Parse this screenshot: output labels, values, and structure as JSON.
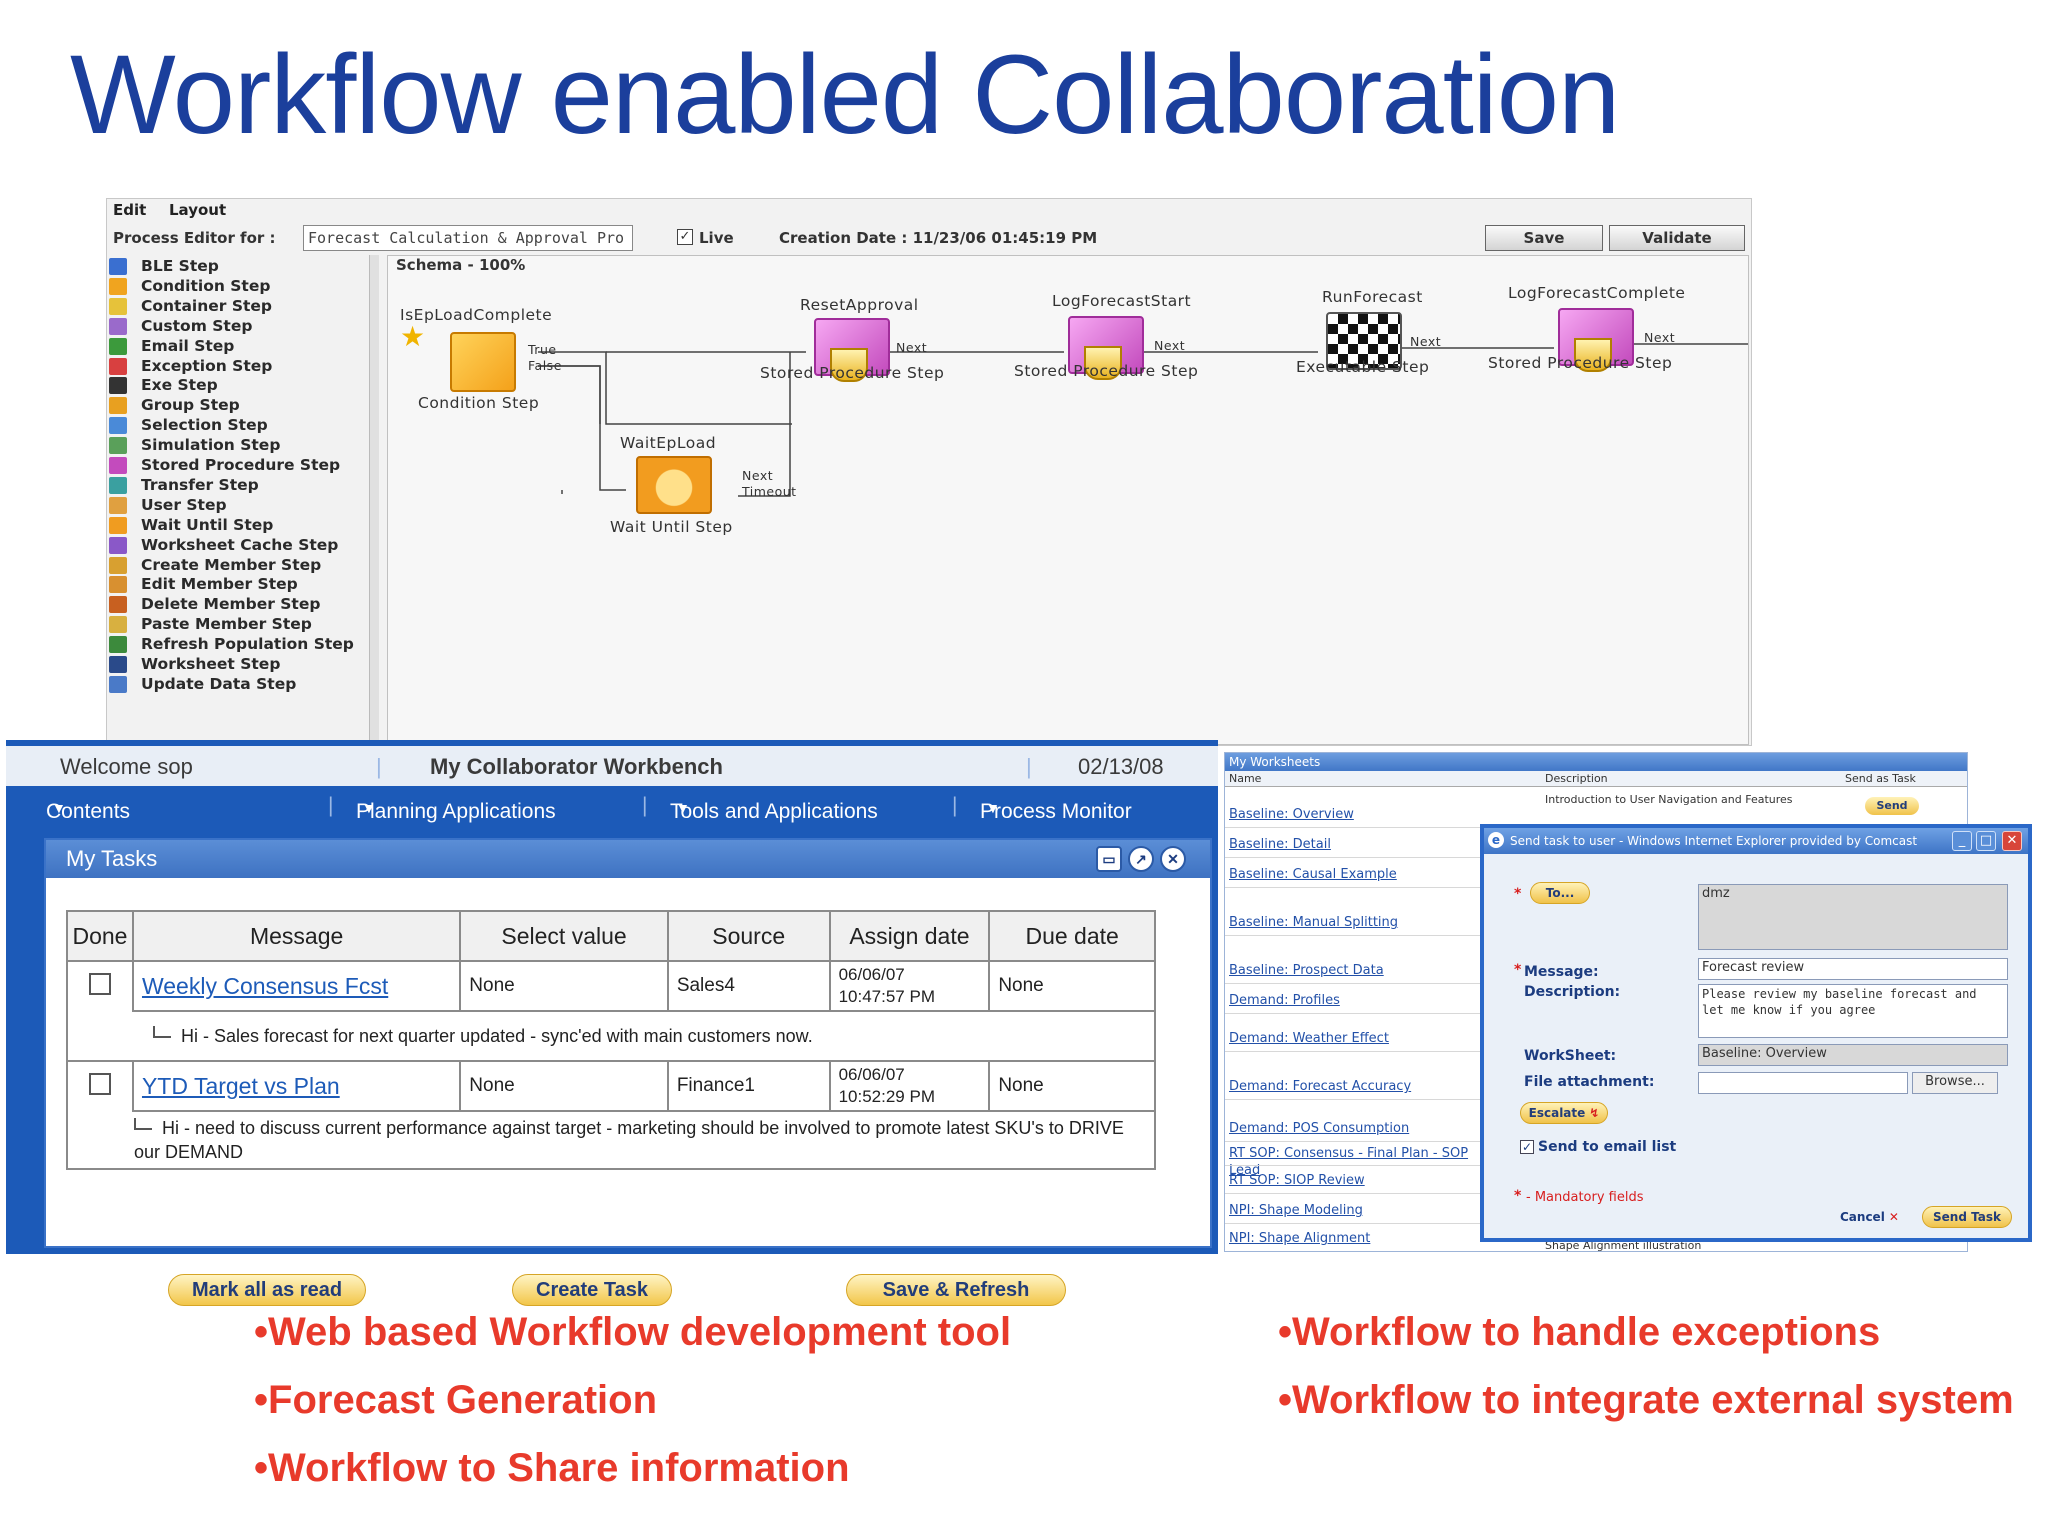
{
  "title": "Workflow enabled Collaboration",
  "editor": {
    "menu": [
      "Edit",
      "Layout"
    ],
    "process_label": "Process Editor for :",
    "process_value": "Forecast Calculation & Approval Pro",
    "live_label": "Live",
    "live_checked": "✓",
    "creation_date": "Creation Date : 11/23/06 01:45:19 PM",
    "save_label": "Save",
    "validate_label": "Validate",
    "schema": "Schema - 100%",
    "palette": [
      {
        "label": "BLE Step",
        "color": "#3a6fd0"
      },
      {
        "label": "Condition Step",
        "color": "#f0a41f"
      },
      {
        "label": "Container Step",
        "color": "#e6c23a"
      },
      {
        "label": "Custom Step",
        "color": "#9a6acb"
      },
      {
        "label": "Email Step",
        "color": "#3c9a3c"
      },
      {
        "label": "Exception Step",
        "color": "#d84040"
      },
      {
        "label": "Exe Step",
        "color": "#333333"
      },
      {
        "label": "Group Step",
        "color": "#e8a020"
      },
      {
        "label": "Selection Step",
        "color": "#4a8ad8"
      },
      {
        "label": "Simulation Step",
        "color": "#5aa05a"
      },
      {
        "label": "Stored Procedure Step",
        "color": "#c34bbd"
      },
      {
        "label": "Transfer Step",
        "color": "#3aa0a0"
      },
      {
        "label": "User Step",
        "color": "#e0a040"
      },
      {
        "label": "Wait Until Step",
        "color": "#f09c20"
      },
      {
        "label": "Worksheet Cache Step",
        "color": "#8a58c8"
      },
      {
        "label": "Create Member Step",
        "color": "#d8a030"
      },
      {
        "label": "Edit Member Step",
        "color": "#d89030"
      },
      {
        "label": "Delete Member Step",
        "color": "#c86020"
      },
      {
        "label": "Paste Member Step",
        "color": "#d8b040"
      },
      {
        "label": "Refresh Population Step",
        "color": "#3c8a3c"
      },
      {
        "label": "Worksheet Step",
        "color": "#2a4a8a"
      },
      {
        "label": "Update Data Step",
        "color": "#4a7ac8"
      }
    ],
    "nodes": {
      "cond_name": "IsEpLoadComplete",
      "cond_type": "Condition Step",
      "true": "True",
      "false": "False",
      "reset_name": "ResetApproval",
      "reset_type": "Stored Procedure Step",
      "log_start_name": "LogForecastStart",
      "log_start_type": "Stored Procedure Step",
      "run_name": "RunForecast",
      "run_type": "Executable Step",
      "log_complete_name": "LogForecastComplete",
      "log_complete_type": "Stored Procedure Step",
      "wait_name": "WaitEpLoad",
      "wait_type": "Wait Until Step",
      "next": "Next",
      "timeout": "Timeout"
    }
  },
  "workbench": {
    "welcome": "Welcome sop",
    "title": "My Collaborator Workbench",
    "date": "02/13/08",
    "nav": [
      "Contents",
      "Planning Applications",
      "Tools and Applications",
      "Process Monitor"
    ],
    "tasks_title": "My Tasks",
    "columns": [
      "Done",
      "Message",
      "Select value",
      "Source",
      "Assign date",
      "Due date"
    ],
    "rows": [
      {
        "message": "Weekly Consensus Fcst",
        "select": "None",
        "source": "Sales4",
        "assign_date": "06/06/07",
        "assign_time": "10:47:57 PM",
        "due": "None",
        "note": "Hi - Sales forecast for next quarter updated - sync'ed with main customers now."
      },
      {
        "message": "YTD Target vs Plan",
        "select": "None",
        "source": "Finance1",
        "assign_date": "06/06/07",
        "assign_time": "10:52:29 PM",
        "due": "None",
        "note": "Hi - need to discuss current performance against target - marketing should be involved to promote latest SKU's to DRIVE our DEMAND"
      }
    ],
    "buttons": [
      "Mark all as read",
      "Create Task",
      "Save & Refresh"
    ]
  },
  "worksheets": {
    "title": "My Worksheets",
    "columns": [
      "Name",
      "Description",
      "Send as Task"
    ],
    "first_desc": "Introduction to User Navigation and Features",
    "send_label": "Send",
    "items": [
      "Baseline: Overview",
      "Baseline: Detail",
      "Baseline: Causal Example",
      "Baseline: Manual Splitting",
      "Baseline: Prospect Data",
      "Demand: Profiles",
      "Demand: Weather Effect",
      "Demand: Forecast Accuracy",
      "Demand: POS Consumption",
      "RT SOP: Consensus - Final Plan - SOP Lead",
      "RT SOP: SIOP Review",
      "NPI: Shape Modeling",
      "NPI: Shape Alignment"
    ],
    "last_desc": "Shape Alignment illustration"
  },
  "dialog": {
    "title": "Send task to user - Windows Internet Explorer provided by Comcast",
    "to_label": "To...",
    "to_value": "dmz",
    "message_label": "Message:",
    "message_value": "Forecast review",
    "description_label": "Description:",
    "description_value": "Please review my baseline forecast and let me know if you agree",
    "worksheet_label": "WorkSheet:",
    "worksheet_value": "Baseline: Overview",
    "attachment_label": "File attachment:",
    "browse_label": "Browse...",
    "escalate_label": "Escalate",
    "email_label": "Send to email list",
    "email_checked": "✓",
    "mandatory": "- Mandatory fields",
    "cancel_label": "Cancel",
    "send_label": "Send Task"
  },
  "bullets": {
    "left": [
      "•Web based Workflow development tool",
      "•Forecast Generation",
      "•Workflow to Share information"
    ],
    "right": [
      "•Workflow to handle exceptions",
      "•Workflow to integrate external system"
    ]
  }
}
